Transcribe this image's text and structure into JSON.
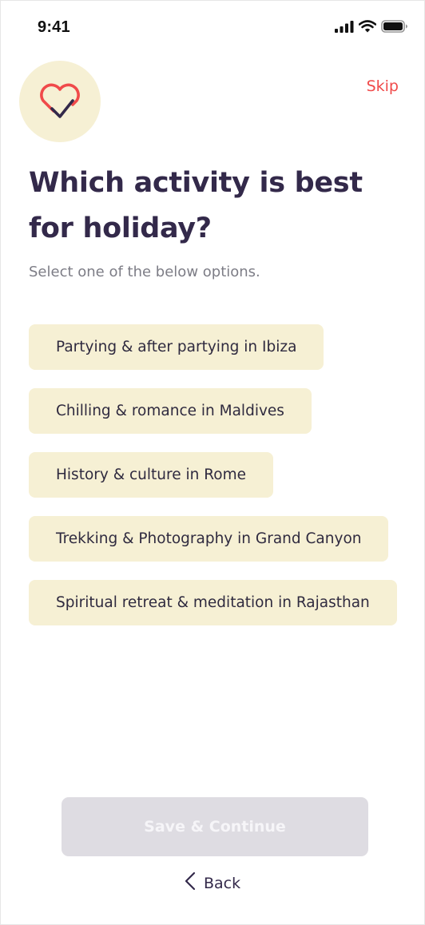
{
  "status_bar": {
    "time": "9:41"
  },
  "header": {
    "skip_label": "Skip",
    "logo_icon": "heart-check-icon"
  },
  "question": {
    "title": "Which activity is best for holiday?",
    "subtitle": "Select one of the below options."
  },
  "options": [
    {
      "label": "Partying & after partying in Ibiza"
    },
    {
      "label": "Chilling & romance in Maldives"
    },
    {
      "label": "History & culture in Rome"
    },
    {
      "label": "Trekking & Photography in Grand Canyon"
    },
    {
      "label": "Spiritual retreat & meditation in Rajasthan"
    }
  ],
  "footer": {
    "save_label": "Save & Continue",
    "back_label": "Back"
  },
  "colors": {
    "accent_red": "#f04a4a",
    "title": "#33294a",
    "option_bg": "#f6f0d4",
    "button_disabled_bg": "#dedce2"
  }
}
